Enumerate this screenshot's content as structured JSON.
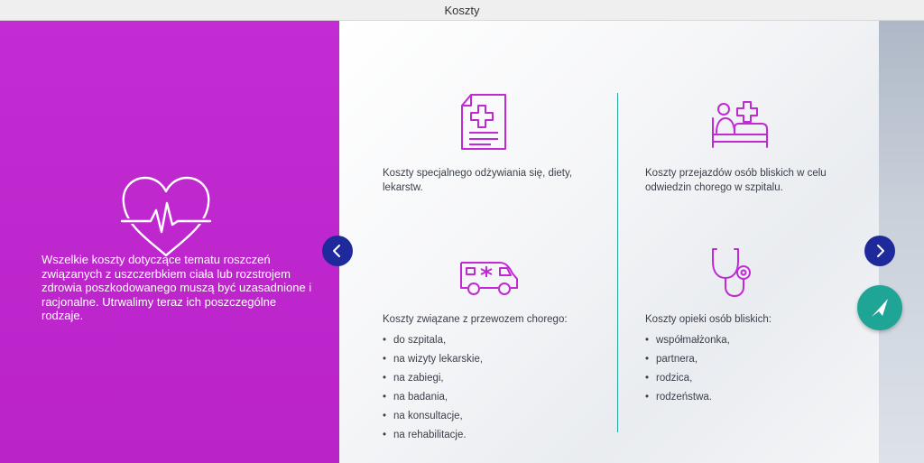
{
  "window": {
    "title": "Koszty"
  },
  "intro": {
    "text": "Wszelkie koszty dotyczące tematu roszczeń związanych z uszczerbkiem ciała lub rozstrojem zdrowia poszkodowanego muszą być uzasadnione i racjonalne. Utrwalimy teraz ich poszczególne rodzaje."
  },
  "cards": {
    "diet": {
      "text": "Koszty specjalnego odżywiania się, diety, lekarstw."
    },
    "travel": {
      "text": "Koszty przejazdów osób bliskich w celu odwiedzin chorego w szpitalu."
    },
    "transport": {
      "heading": "Koszty związane z przewozem chorego:",
      "items": [
        "do szpitala,",
        "na wizyty lekarskie,",
        "na zabiegi,",
        "na badania,",
        "na konsultacje,",
        "na rehabilitacje."
      ]
    },
    "care": {
      "heading": "Koszty opieki osób bliskich:",
      "items": [
        "współmałżonka,",
        "partnera,",
        "rodzica,",
        "rodzeństwa."
      ]
    }
  },
  "colors": {
    "accent": "#c12ad2",
    "icon": "#c12ad2",
    "nav": "#1e2a9c",
    "teal": "#1fa596"
  },
  "icons": {
    "heart": "heartbeat-icon",
    "document": "medical-document-icon",
    "bed": "hospital-bed-icon",
    "ambulance": "ambulance-icon",
    "stethoscope": "stethoscope-icon",
    "prev": "chevron-left-icon",
    "next": "chevron-right-icon",
    "fab": "navigation-arrow-icon"
  }
}
